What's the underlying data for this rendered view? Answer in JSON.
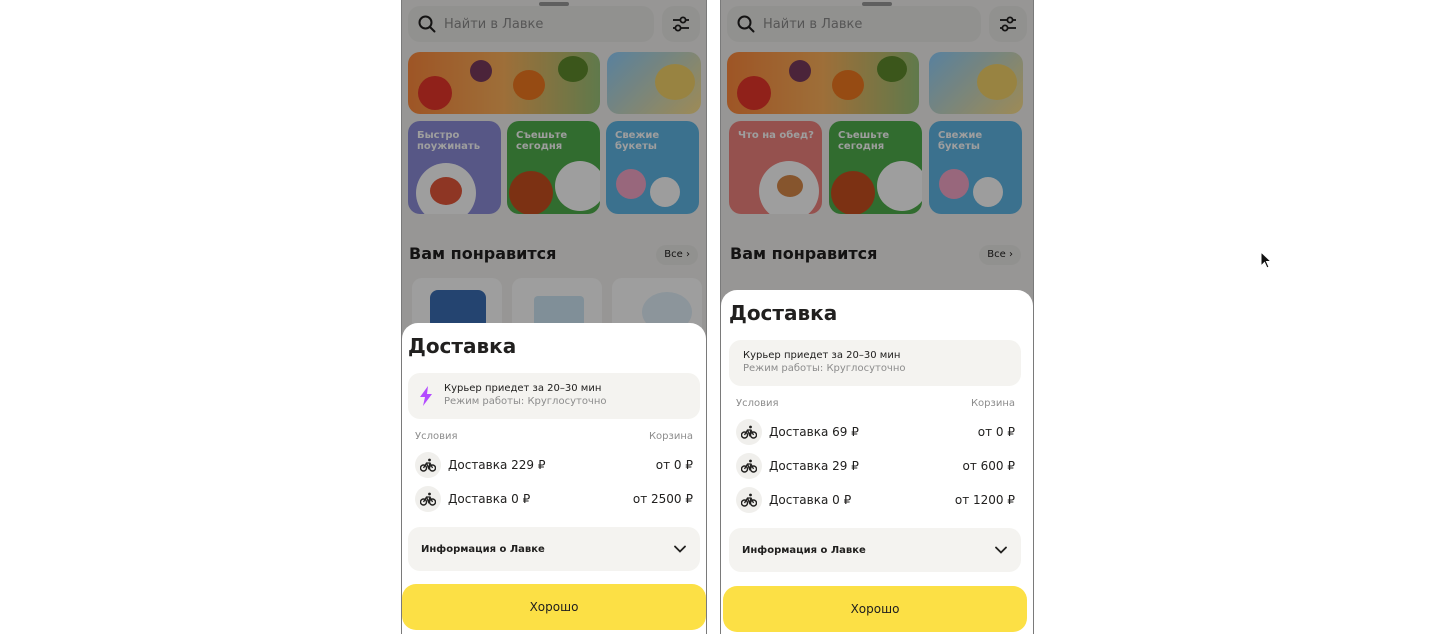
{
  "screens": {
    "left": {
      "search_placeholder": "Найти в Лавке",
      "tiles": [
        "Быстро поужинать",
        "Съешьте сегодня",
        "Свежие букеты"
      ],
      "section_title": "Вам понравится",
      "all_label": "Все",
      "sheet": {
        "title": "Доставка",
        "courier_line1": "Курьер приедет за 20–30 мин",
        "courier_line2": "Режим работы: Круглосуточно",
        "conditions_label": "Условия",
        "cart_label": "Корзина",
        "rows": [
          {
            "label": "Доставка 229 ₽",
            "value": "от 0 ₽"
          },
          {
            "label": "Доставка 0 ₽",
            "value": "от 2500 ₽"
          }
        ],
        "info_label": "Информация о Лавке",
        "ok_label": "Хорошо"
      }
    },
    "right": {
      "search_placeholder": "Найти в Лавке",
      "tiles": [
        "Что на обед?",
        "Съешьте сегодня",
        "Свежие букеты"
      ],
      "section_title": "Вам понравится",
      "all_label": "Все",
      "sheet": {
        "title": "Доставка",
        "courier_line1": "Курьер приедет за 20–30 мин",
        "courier_line2": "Режим работы: Круглосуточно",
        "conditions_label": "Условия",
        "cart_label": "Корзина",
        "rows": [
          {
            "label": "Доставка 69 ₽",
            "value": "от 0 ₽"
          },
          {
            "label": "Доставка 29 ₽",
            "value": "от 600 ₽"
          },
          {
            "label": "Доставка 0 ₽",
            "value": "от 1200 ₽"
          }
        ],
        "info_label": "Информация о Лавке",
        "ok_label": "Хорошо"
      }
    }
  },
  "colors": {
    "accent_yellow": "#fce045",
    "bolt_purple": "#b34bff",
    "text_primary": "#21201f",
    "text_secondary": "#8c8c8c"
  },
  "icons": [
    "search-icon",
    "filter-icon",
    "chevron-right-icon",
    "lightning-icon",
    "bicycle-icon",
    "chevron-down-icon",
    "mouse-cursor-icon"
  ]
}
